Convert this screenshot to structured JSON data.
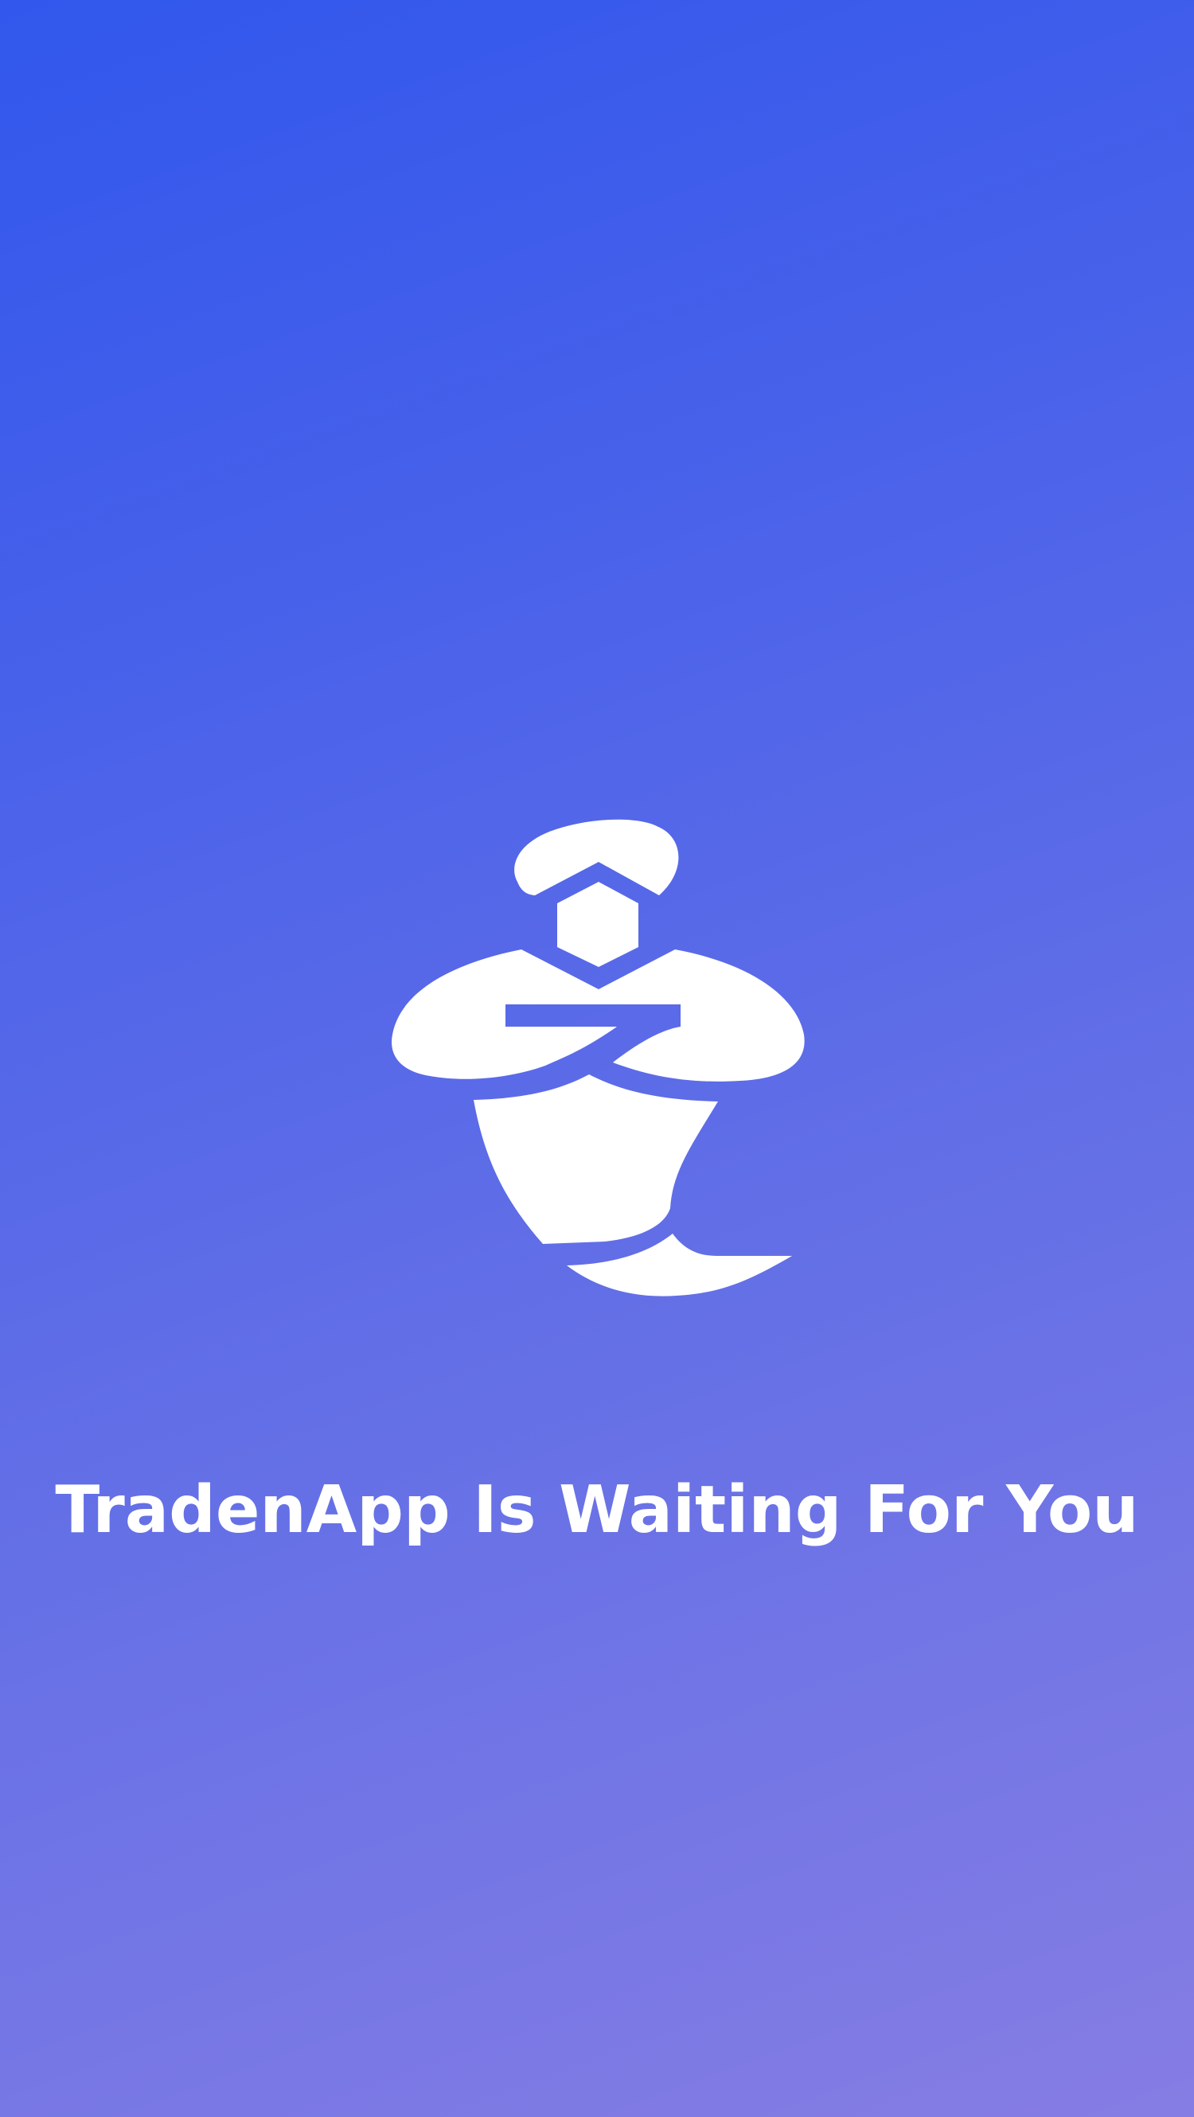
{
  "splash": {
    "logo_icon": "genie-lamp-rupee-logo-icon",
    "tagline": "TradenApp Is Waiting For You"
  },
  "colors": {
    "gradient_start": "#3157ec",
    "gradient_end": "#867de4",
    "logo": "#ffffff",
    "text": "#ffffff"
  }
}
